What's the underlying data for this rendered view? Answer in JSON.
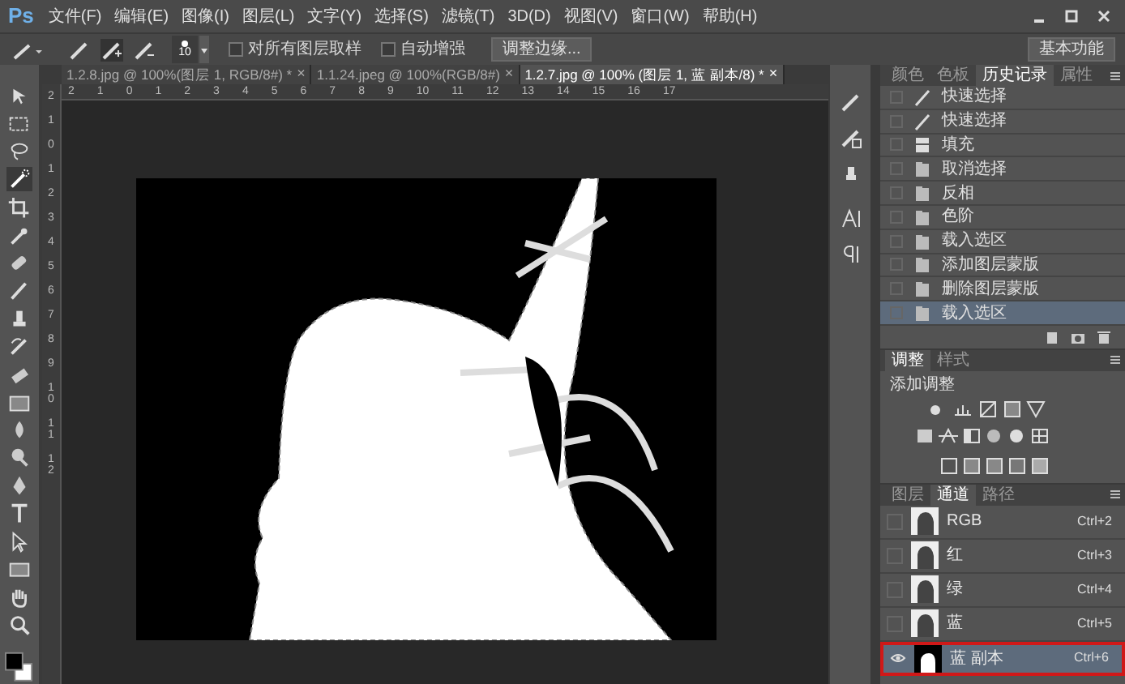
{
  "app": {
    "logo": "Ps"
  },
  "menu": [
    "文件(F)",
    "编辑(E)",
    "图像(I)",
    "图层(L)",
    "文字(Y)",
    "选择(S)",
    "滤镜(T)",
    "3D(D)",
    "视图(V)",
    "窗口(W)",
    "帮助(H)"
  ],
  "options_bar": {
    "brush_size": "10",
    "checkboxes": [
      {
        "label": "对所有图层取样",
        "checked": false
      },
      {
        "label": "自动增强",
        "checked": false
      }
    ],
    "refine_button": "调整边缘...",
    "workspace": "基本功能"
  },
  "document_tabs": [
    {
      "title": "1.2.8.jpg @ 100%(图层 1, RGB/8#) *",
      "close": "×",
      "selected": false
    },
    {
      "title": "1.1.24.jpeg @ 100%(RGB/8#)",
      "close": "×",
      "selected": false
    },
    {
      "title": "1.2.7.jpg @ 100% (图层 1, 蓝 副本/8) *",
      "close": "×",
      "selected": true
    }
  ],
  "ruler": {
    "horizontal": [
      "2",
      "1",
      "0",
      "1",
      "2",
      "3",
      "4",
      "5",
      "6",
      "7",
      "8",
      "9",
      "10",
      "11",
      "12",
      "13",
      "14",
      "15",
      "16",
      "17"
    ],
    "vertical": [
      "2",
      "1",
      "0",
      "1",
      "2",
      "3",
      "4",
      "5",
      "6",
      "7",
      "8",
      "9",
      "10",
      "11",
      "12"
    ]
  },
  "history_panel": {
    "tabs": [
      {
        "label": "颜色",
        "selected": false
      },
      {
        "label": "色板",
        "selected": false
      },
      {
        "label": "历史记录",
        "selected": true
      },
      {
        "label": "属性",
        "selected": false
      }
    ],
    "items": [
      {
        "label": "快速选择",
        "kind": "brush",
        "selected": false
      },
      {
        "label": "快速选择",
        "kind": "brush",
        "selected": false
      },
      {
        "label": "填充",
        "kind": "fill",
        "selected": false
      },
      {
        "label": "取消选择",
        "kind": "step",
        "selected": false
      },
      {
        "label": "反相",
        "kind": "step",
        "selected": false
      },
      {
        "label": "色阶",
        "kind": "step",
        "selected": false
      },
      {
        "label": "载入选区",
        "kind": "step",
        "selected": false
      },
      {
        "label": "添加图层蒙版",
        "kind": "step",
        "selected": false
      },
      {
        "label": "删除图层蒙版",
        "kind": "step",
        "selected": false
      },
      {
        "label": "载入选区",
        "kind": "step",
        "selected": true
      }
    ]
  },
  "adjustments_panel": {
    "tabs": [
      {
        "label": "调整",
        "selected": true
      },
      {
        "label": "样式",
        "selected": false
      }
    ],
    "heading": "添加调整"
  },
  "channels_panel": {
    "tabs": [
      {
        "label": "图层",
        "selected": false
      },
      {
        "label": "通道",
        "selected": true
      },
      {
        "label": "路径",
        "selected": false
      }
    ],
    "channels": [
      {
        "name": "RGB",
        "shortcut": "Ctrl+2",
        "visible": false,
        "selected": false
      },
      {
        "name": "红",
        "shortcut": "Ctrl+3",
        "visible": false,
        "selected": false
      },
      {
        "name": "绿",
        "shortcut": "Ctrl+4",
        "visible": false,
        "selected": false
      },
      {
        "name": "蓝",
        "shortcut": "Ctrl+5",
        "visible": false,
        "selected": false
      },
      {
        "name": "蓝 副本",
        "shortcut": "Ctrl+6",
        "visible": true,
        "selected": true
      }
    ]
  }
}
